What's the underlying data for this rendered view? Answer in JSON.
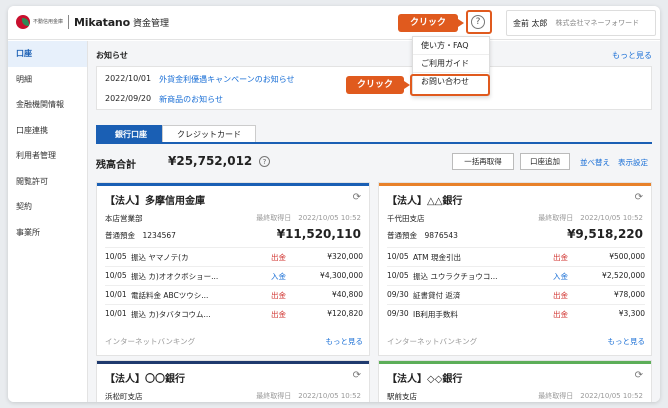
{
  "header": {
    "bank_name": "不動信用金庫",
    "brand": "Mikatano",
    "brand_sub": "資金管理",
    "help_glyph": "?",
    "user_name": "金前 太郎",
    "company": "株式会社マネーフォワード"
  },
  "callouts": [
    "クリック",
    "クリック"
  ],
  "help_menu": [
    "使い方・FAQ",
    "ご利用ガイド",
    "お問い合わせ"
  ],
  "sidebar": {
    "items": [
      "口座",
      "明細",
      "金融機関情報",
      "口座連携",
      "利用者管理",
      "閲覧許可",
      "契約",
      "事業所"
    ]
  },
  "notices": {
    "title": "お知らせ",
    "more": "もっと見る",
    "items": [
      {
        "date": "2022/10/01",
        "text": "外貨金利優遇キャンペーンのお知らせ"
      },
      {
        "date": "2022/09/20",
        "text": "新商品のお知らせ"
      }
    ]
  },
  "tabs": [
    "銀行口座",
    "クレジットカード"
  ],
  "summary": {
    "label": "残高合計",
    "total": "¥25,752,012",
    "help_glyph": "?",
    "buttons": [
      "一括再取得",
      "口座追加"
    ],
    "links": [
      "並べ替え",
      "表示設定"
    ]
  },
  "accounts": [
    {
      "name": "【法人】多摩信用金庫",
      "branch": "本店営業部",
      "fetched": "最終取得日　2022/10/05 10:52",
      "type": "普通預金　1234567",
      "balance": "¥11,520,110",
      "color": "#1a5fb4",
      "transactions": [
        {
          "date": "10/05",
          "desc": "振込 ヤマノテ(カ",
          "kind": "出金",
          "amount": "¥320,000"
        },
        {
          "date": "10/05",
          "desc": "振込 カ)オオクボショー...",
          "kind": "入金",
          "amount": "¥4,300,000"
        },
        {
          "date": "10/01",
          "desc": "電話料金 ABCツウシ...",
          "kind": "出金",
          "amount": "¥40,800"
        },
        {
          "date": "10/01",
          "desc": "振込 カ)タバタコウム...",
          "kind": "出金",
          "amount": "¥120,820"
        }
      ],
      "footer": "インターネットバンキング",
      "more": "もっと見る"
    },
    {
      "name": "【法人】△△銀行",
      "branch": "千代田支店",
      "fetched": "最終取得日　2022/10/05 10:52",
      "type": "普通預金　9876543",
      "balance": "¥9,518,220",
      "color": "#e8812a",
      "transactions": [
        {
          "date": "10/05",
          "desc": "ATM 現金引出",
          "kind": "出金",
          "amount": "¥500,000"
        },
        {
          "date": "10/05",
          "desc": "振込 ユウラクチョウコ...",
          "kind": "入金",
          "amount": "¥2,520,000"
        },
        {
          "date": "09/30",
          "desc": "証書貸付 返済",
          "kind": "出金",
          "amount": "¥78,000"
        },
        {
          "date": "09/30",
          "desc": "IB利用手数料",
          "kind": "出金",
          "amount": "¥3,300"
        }
      ],
      "footer": "インターネットバンキング",
      "more": "もっと見る"
    },
    {
      "name": "【法人】〇〇銀行",
      "branch": "浜松町支店",
      "fetched": "最終取得日　2022/10/05 10:52",
      "color": "#1f3a6e"
    },
    {
      "name": "【法人】◇◇銀行",
      "branch": "駅前支店",
      "fetched": "最終取得日　2022/10/05 10:52",
      "color": "#5cae58"
    }
  ]
}
